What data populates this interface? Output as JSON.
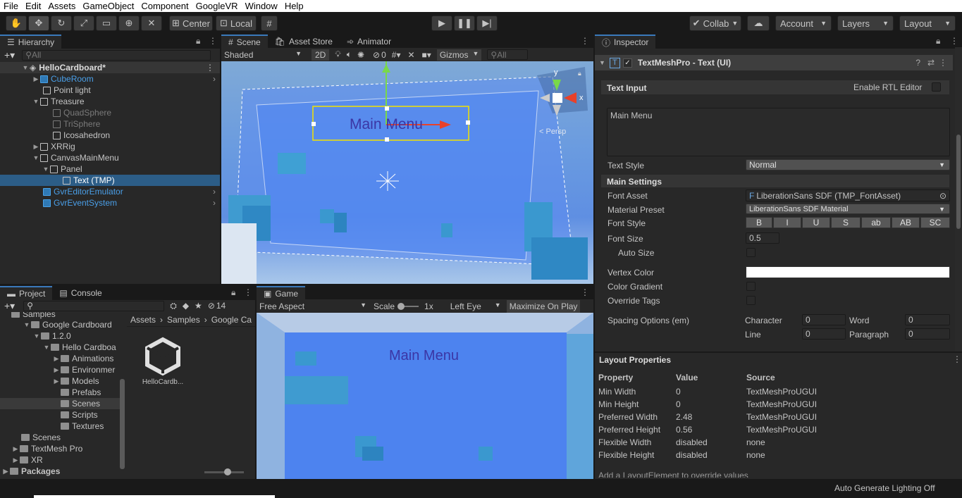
{
  "menu": [
    "File",
    "Edit",
    "Assets",
    "GameObject",
    "Component",
    "GoogleVR",
    "Window",
    "Help"
  ],
  "toolbar": {
    "center": "Center",
    "local": "Local",
    "collab": "Collab",
    "account": "Account",
    "layers": "Layers",
    "layout": "Layout"
  },
  "hierarchy": {
    "tab": "Hierarchy",
    "search_placeholder": "All",
    "scene": "HelloCardboard*",
    "items": [
      {
        "label": "CubeRoom"
      },
      {
        "label": "Point light"
      },
      {
        "label": "Treasure"
      },
      {
        "label": "QuadSphere"
      },
      {
        "label": "TriSphere"
      },
      {
        "label": "Icosahedron"
      },
      {
        "label": "XRRig"
      },
      {
        "label": "CanvasMainMenu"
      },
      {
        "label": "Panel"
      },
      {
        "label": "Text (TMP)"
      },
      {
        "label": "GvrEditorEmulator"
      },
      {
        "label": "GvrEventSystem"
      }
    ]
  },
  "scene_view": {
    "tabs": [
      "Scene",
      "Asset Store",
      "Animator"
    ],
    "shading": "Shaded",
    "mode_2d": "2D",
    "hidden_count": "0",
    "gizmos": "Gizmos",
    "search_placeholder": "All",
    "canvas_text": "Main Menu",
    "persp": "< Persp",
    "axis_x": "x",
    "axis_y": "y"
  },
  "inspector": {
    "tab": "Inspector",
    "component": "TextMeshPro - Text (UI)",
    "text_input_header": "Text Input",
    "rtl": "Enable RTL Editor",
    "text_value": "Main Menu",
    "text_style_label": "Text Style",
    "text_style": "Normal",
    "main_settings": "Main Settings",
    "font_asset_label": "Font Asset",
    "font_asset": "LiberationSans SDF (TMP_FontAsset)",
    "material_preset_label": "Material Preset",
    "material_preset": "LiberationSans SDF Material",
    "font_style_label": "Font Style",
    "font_styles": [
      "B",
      "I",
      "U",
      "S",
      "ab",
      "AB",
      "SC"
    ],
    "font_size_label": "Font Size",
    "font_size": "0.5",
    "auto_size_label": "Auto Size",
    "vertex_color_label": "Vertex Color",
    "vertex_color": "#ffffff",
    "color_gradient_label": "Color Gradient",
    "override_tags_label": "Override Tags",
    "spacing_label": "Spacing Options (em)",
    "character_label": "Character",
    "character": "0",
    "word_label": "Word",
    "word": "0",
    "line_label": "Line",
    "line": "0",
    "paragraph_label": "Paragraph",
    "paragraph": "0"
  },
  "layout_props": {
    "title": "Layout Properties",
    "headers": [
      "Property",
      "Value",
      "Source"
    ],
    "rows": [
      [
        "Min Width",
        "0",
        "TextMeshProUGUI"
      ],
      [
        "Min Height",
        "0",
        "TextMeshProUGUI"
      ],
      [
        "Preferred Width",
        "2.48",
        "TextMeshProUGUI"
      ],
      [
        "Preferred Height",
        "0.56",
        "TextMeshProUGUI"
      ],
      [
        "Flexible Width",
        "disabled",
        "none"
      ],
      [
        "Flexible Height",
        "disabled",
        "none"
      ]
    ],
    "footer": "Add a LayoutElement to override values"
  },
  "project": {
    "tabs": [
      "Project",
      "Console"
    ],
    "hidden_count": "14",
    "tree": [
      "Samples",
      "Google Cardboard",
      "1.2.0",
      "Hello Cardboa",
      "Animations",
      "Environmer",
      "Models",
      "Prefabs",
      "Scenes",
      "Scripts",
      "Textures",
      "Scenes",
      "TextMesh Pro",
      "XR",
      "Packages"
    ],
    "breadcrumb": [
      "Assets",
      "Samples",
      "Google Ca"
    ],
    "asset_label": "HelloCardb..."
  },
  "game": {
    "tab": "Game",
    "aspect": "Free Aspect",
    "scale_label": "Scale",
    "scale_value": "1x",
    "eye": "Left Eye",
    "maximize": "Maximize On Play",
    "canvas_text": "Main Menu"
  },
  "status": {
    "text": "Auto Generate Lighting Off"
  }
}
